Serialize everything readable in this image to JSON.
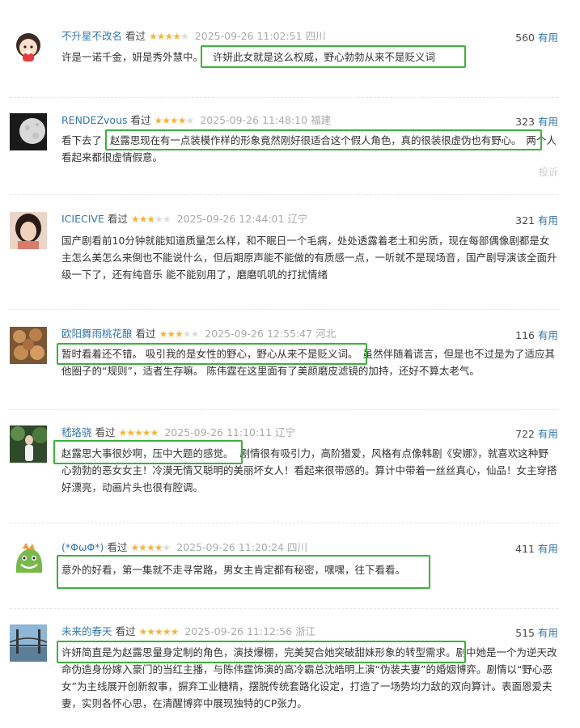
{
  "accent_colors": {
    "username": "#3377aa",
    "highlight_box": "#3cb13c",
    "star": "#f4b53f",
    "meta_gray": "#aaaaaa"
  },
  "comments": [
    {
      "user": "不升星不改名",
      "watched": "看过",
      "rating": 4,
      "time": "2025-09-26 11:02:51",
      "location": "四川",
      "votes": "560",
      "votes_label": "有用",
      "text_pre": "许是一诺千金，妍是秀外慧中。",
      "text_hl": "许妍此女就是这么权威，野心勃勃从来不是贬义词",
      "text_post": ""
    },
    {
      "user": "RENDEZvous",
      "watched": "看过",
      "rating": 4,
      "time": "2025-09-26 11:48:10",
      "location": "福建",
      "votes": "323",
      "votes_label": "有用",
      "text_pre": "看下去了",
      "text_hl": "赵露思现在有一点装模作样的形象竟然刚好很适合这个假人角色，真的很装很虚伪也有野心。",
      "text_post": "两个人看起来都很虚情假意。",
      "report": "投诉"
    },
    {
      "user": "ICIECIVE",
      "watched": "看过",
      "rating": 3,
      "time": "2025-09-26 12:44:01",
      "location": "辽宁",
      "votes": "321",
      "votes_label": "有用",
      "text_pre": "国产剧看前10分钟就能知道质量怎么样，和不眠日一个毛病，处处透露着老土和劣质，现在每部偶像剧都是女主怎么美怎么来倒也不能说什么，但后期原声能不能做的有质感一点，一听就不是现场音，国产剧导演该全面升级一下了，还有纯音乐 能不能别用了，磨磨叽叽的打扰情绪",
      "text_hl": "",
      "text_post": ""
    },
    {
      "user": "欧阳舞雨桃花酿",
      "watched": "看过",
      "rating": 3,
      "time": "2025-09-26 12:55:47",
      "location": "河北",
      "votes": "116",
      "votes_label": "有用",
      "text_pre": "",
      "text_hl": "暂时看着还不错。 吸引我的是女性的野心，野心从来不是贬义词。",
      "text_post": "虽然伴随着谎言，但是也不过是为了适应其他圈子的“规则”，适者生存嘛。 陈伟霆在这里面有了美颜磨皮滤镜的加持，还好不算太老气。"
    },
    {
      "user": "嵇珞骁",
      "watched": "看过",
      "rating": 5,
      "time": "2025-09-26 11:10:11",
      "location": "辽宁",
      "votes": "722",
      "votes_label": "有用",
      "text_pre": "",
      "text_hl": "赵露思大事很妙啊，压中大题的感觉。",
      "text_post": "剧情很有吸引力，高阶猎爱，风格有点像韩剧《安娜》，就喜欢这种野心勃勃的恶女女主！冷漠无情又聪明的美丽坏女人！看起来很带感的。算计中带着一丝丝真心，仙品！女主穿搭好漂亮，动画片头也很有腔调。"
    },
    {
      "user": "(*ΦωΦ*)",
      "watched": "看过",
      "rating": 4,
      "time": "2025-09-26 11:20:24",
      "location": "四川",
      "votes": "411",
      "votes_label": "有用",
      "text_pre": "",
      "text_hl": "意外的好看，第一集就不走寻常路，男女主肯定都有秘密，嘿嘿，往下看看。",
      "text_post": ""
    },
    {
      "user": "未来的春天",
      "watched": "看过",
      "rating": 5,
      "time": "2025-09-26 11:12:56",
      "location": "浙江",
      "votes": "515",
      "votes_label": "有用",
      "text_pre": "",
      "text_hl": "许妍简直是为赵露思量身定制的角色，演技爆棚，完美契合她突破甜妹形象的转型需求",
      "text_post": "。剧中她是一个为逆天改命伪造身份嫁入豪门的当红主播，与陈伟霆饰演的高冷霸总沈皓明上演“伪装夫妻”的婚姻博弈。剧情以“野心恶女”为主线展开创新叙事，摒弃工业糖精，摆脱传统套路化设定，打造了一场势均力敌的双向算计。表面恩爱夫妻，实则各怀心思，在清醒博弈中展现独特的CP张力。"
    }
  ]
}
